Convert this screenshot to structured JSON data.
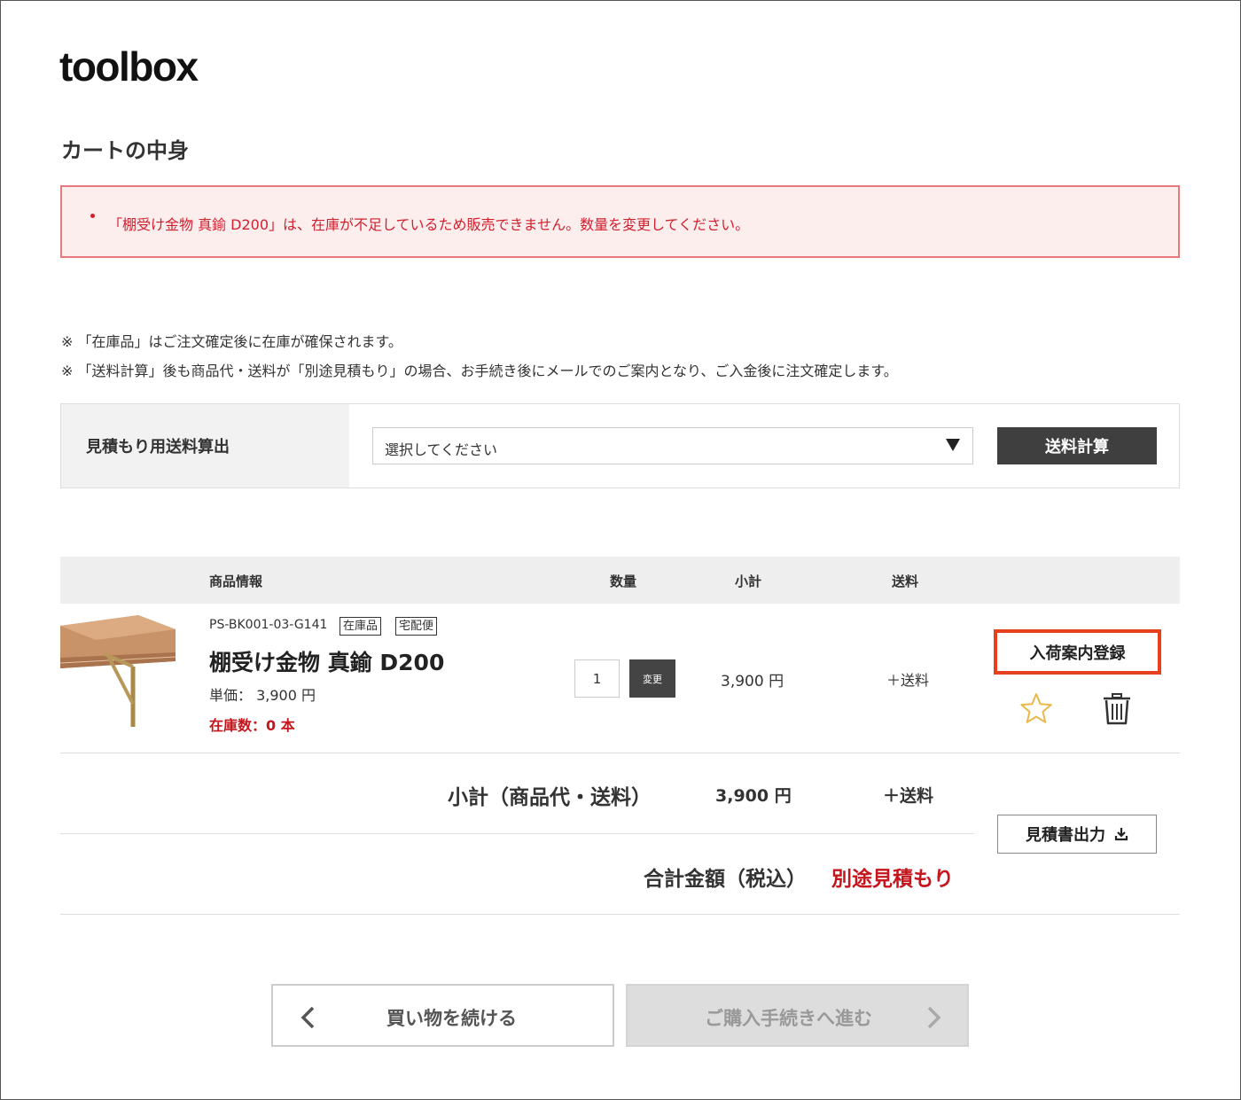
{
  "logo": "toolbox",
  "page_title": "カートの中身",
  "alert": {
    "message": "「棚受け金物 真鍮 D200」は、在庫が不足しているため販売できません。数量を変更してください。"
  },
  "notes": [
    "※ 「在庫品」はご注文確定後に在庫が確保されます。",
    "※ 「送料計算」後も商品代・送料が「別途見積もり」の場合、お手続き後にメールでのご案内となり、ご入金後に注文確定します。"
  ],
  "shipping_estimator": {
    "label": "見積もり用送料算出",
    "select_value": "選択してください",
    "calc_button": "送料計算"
  },
  "cart_table": {
    "headers": {
      "product": "商品情報",
      "quantity": "数量",
      "subtotal": "小計",
      "shipping": "送料"
    },
    "items": [
      {
        "sku": "PS-BK001-03-G141",
        "tags": [
          "在庫品",
          "宅配便"
        ],
        "name": "棚受け金物 真鍮 D200",
        "unit_price": "単価： 3,900 円",
        "stock": "在庫数：0 本",
        "quantity": "1",
        "change_button": "変更",
        "subtotal": "3,900 円",
        "shipping": "＋送料",
        "restock_button": "入荷案内登録",
        "favorite_icon": "star-outline",
        "delete_icon": "trash-can"
      }
    ]
  },
  "summary": {
    "subtotal_label": "小計（商品代・送料）",
    "subtotal_value": "3,900 円",
    "subtotal_shipping": "＋送料",
    "quote_button": "見積書出力",
    "total_label": "合計金額（税込）",
    "total_value": "別途見積もり"
  },
  "navigation": {
    "continue_button": "買い物を続ける",
    "proceed_button": "ご購入手続きへ進む"
  },
  "colors": {
    "alert_red": "#d0202f",
    "highlight_orange": "#e8401c",
    "dark_button": "#3f3f3f"
  }
}
